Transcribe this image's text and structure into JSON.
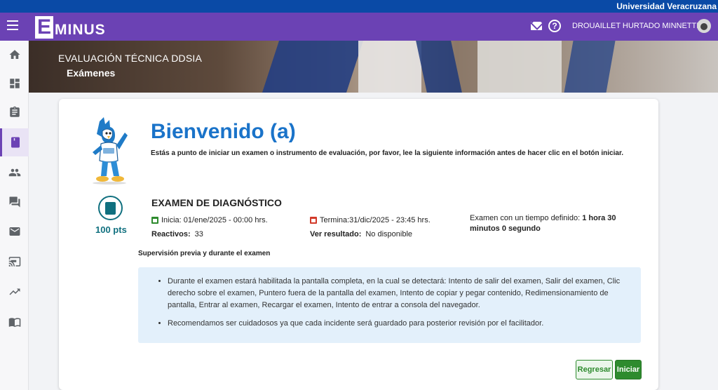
{
  "institution": "Universidad Veracruzana",
  "app": {
    "logo_letter": "E",
    "logo_rest": "MINUS"
  },
  "header": {
    "user_name": "DROUAILLET HURTADO MINNETTE",
    "mail_icon": "mail-icon",
    "help_icon": "help-icon",
    "help_glyph": "?"
  },
  "sidebar": {
    "items": [
      {
        "icon": "home-icon"
      },
      {
        "icon": "dashboard-icon"
      },
      {
        "icon": "clipboard-icon"
      },
      {
        "icon": "book-icon",
        "active": true
      },
      {
        "icon": "people-icon"
      },
      {
        "icon": "forum-icon"
      },
      {
        "icon": "mail-icon"
      },
      {
        "icon": "cast-icon"
      },
      {
        "icon": "trending-icon"
      },
      {
        "icon": "library-icon"
      }
    ]
  },
  "banner": {
    "course": "EVALUACIÓN TÉCNICA DDSIA",
    "section": "Exámenes"
  },
  "welcome": {
    "title": "Bienvenido (a)",
    "instruction": "Estás a punto de iniciar un examen o instrumento de evaluación, por favor, lee la siguiente información antes de hacer clic en el botón iniciar."
  },
  "exam": {
    "points": "100 pts",
    "title": "EXAMEN DE DIAGNÓSTICO",
    "start": "Inicia: 01/ene/2025 - 00:00 hrs.",
    "end": "Termina:31/dic/2025 - 23:45 hrs.",
    "items_label": "Reactivos:",
    "items_value": "33",
    "result_label": "Ver resultado:",
    "result_value": "No disponible",
    "time_prefix": "Examen con un tiempo definido: ",
    "time_value": "1 hora 30 minutos 0 segundo"
  },
  "supervision": {
    "title": "Supervisión previa y durante el examen",
    "bullets": [
      "Durante el examen estará habilitada la pantalla completa, en la cual se detectará: Intento de salir del examen, Salir del examen, Clic derecho sobre el examen, Puntero fuera de la pantalla del examen, Intento de copiar y pegar contenido, Redimensionamiento de pantalla, Entrar al examen, Recargar el examen, Intento de entrar a consola del navegador.",
      "Recomendamos ser cuidadosos ya que cada incidente será guardado para posterior revisión por el facilitador."
    ]
  },
  "buttons": {
    "back": "Regresar",
    "start": "Iniciar"
  },
  "colors": {
    "top_bar": "#0a4aa6",
    "nav": "#6b42b4",
    "title_blue": "#1a73c9",
    "teal": "#10707f",
    "green": "#2e8b2e",
    "notice_bg": "#e3f0fb"
  }
}
